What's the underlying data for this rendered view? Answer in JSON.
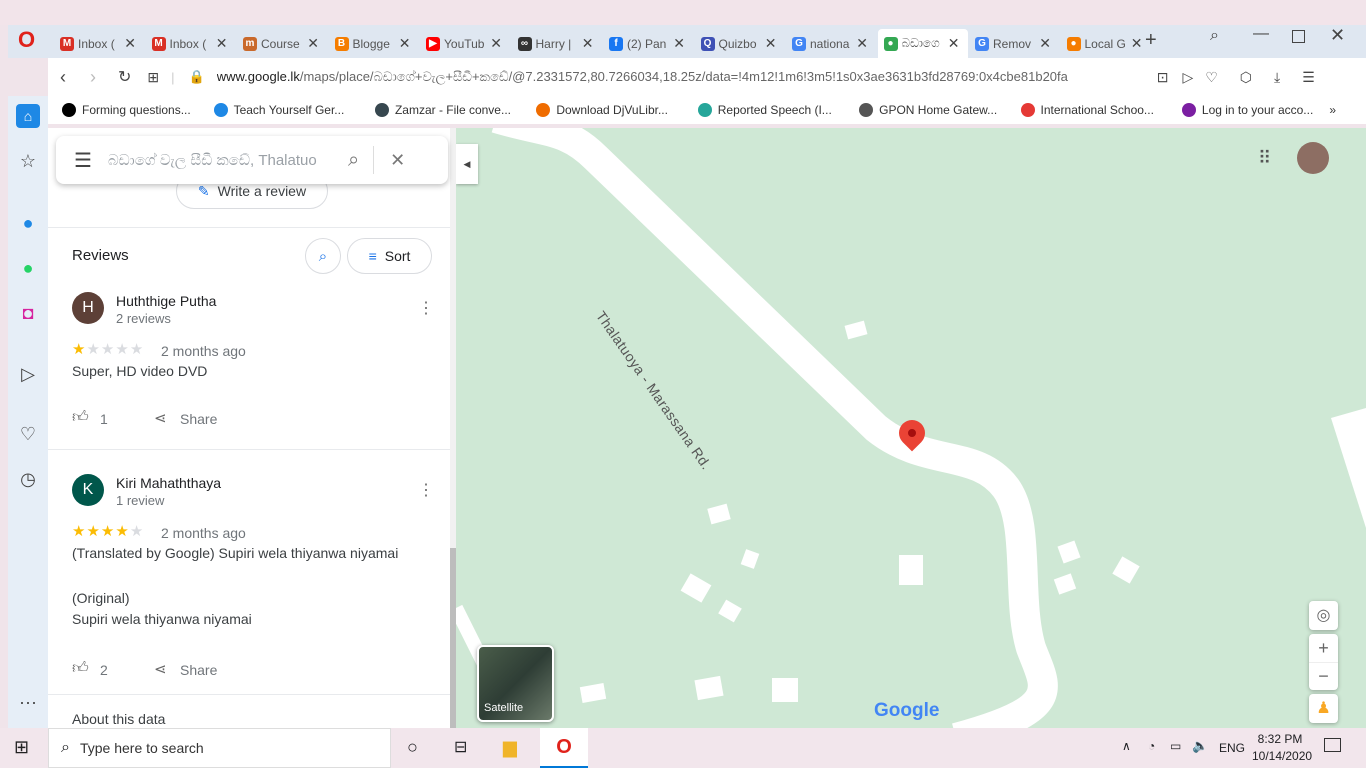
{
  "browser": {
    "tabs": [
      {
        "label": "Inbox (",
        "icon": "gmail-icon",
        "color": "#d93025",
        "glyph": "M"
      },
      {
        "label": "Inbox (",
        "icon": "gmail-icon",
        "color": "#d93025",
        "glyph": "M"
      },
      {
        "label": "Course",
        "icon": "coursera-icon",
        "color": "#c9692b",
        "glyph": "m"
      },
      {
        "label": "Blogge",
        "icon": "blogger-icon",
        "color": "#f57d00",
        "glyph": "B"
      },
      {
        "label": "YouTub",
        "icon": "youtube-icon",
        "color": "#ff0000",
        "glyph": "▶"
      },
      {
        "label": "Harry |",
        "icon": "goodreads-icon",
        "color": "#333333",
        "glyph": "∞"
      },
      {
        "label": "(2) Pan",
        "icon": "facebook-icon",
        "color": "#1877f2",
        "glyph": "f"
      },
      {
        "label": "Quizbo",
        "icon": "quizbox-icon",
        "color": "#3f51b5",
        "glyph": "Q"
      },
      {
        "label": "nationa",
        "icon": "google-icon",
        "color": "#4285f4",
        "glyph": "G"
      },
      {
        "label": "බඩාගෙ",
        "icon": "maps-pin-icon",
        "color": "#34a853",
        "glyph": "●",
        "active": true
      },
      {
        "label": "Remov",
        "icon": "google-icon",
        "color": "#4285f4",
        "glyph": "G"
      },
      {
        "label": "Local G",
        "icon": "location-icon",
        "color": "#f57c00",
        "glyph": "●"
      }
    ],
    "url_domain": "www.google.lk",
    "url_path": "/maps/place/බඩාගේ+වැල+සීඩී+කඩේ/@7.2331572,80.7266034,18.25z/data=!4m12!1m6!3m5!1s0x3ae3631b3fd28769:0x4cbe81b20fa",
    "bookmarks": [
      {
        "label": "Forming questions...",
        "color": "#000000"
      },
      {
        "label": "Teach Yourself Ger...",
        "color": "#1e88e5"
      },
      {
        "label": "Zamzar - File conve...",
        "color": "#37474f"
      },
      {
        "label": "Download DjVuLibr...",
        "color": "#ef6c00"
      },
      {
        "label": "Reported Speech (I...",
        "color": "#26a69a"
      },
      {
        "label": "GPON Home Gatew...",
        "color": "#555555"
      },
      {
        "label": "International Schoo...",
        "color": "#e53935"
      },
      {
        "label": "Log in to your acco...",
        "color": "#7b1fa2"
      }
    ],
    "more": "»"
  },
  "maps": {
    "search_value": "බඩාගේ වැල සීඩී කඩේ, Thalatuo",
    "write_review": "Write a review",
    "reviews_title": "Reviews",
    "sort_label": "Sort",
    "reviews": [
      {
        "initial": "H",
        "avatar_color": "#5d4037",
        "name": "Huththige Putha",
        "count": "2 reviews",
        "rating": 1,
        "time": "2 months ago",
        "text": "Super, HD video DVD",
        "likes": "1",
        "share": "Share"
      },
      {
        "initial": "K",
        "avatar_color": "#00574b",
        "name": "Kiri Mahaththaya",
        "count": "1 review",
        "rating": 4,
        "time": "2 months ago",
        "text": "(Translated by Google) Supiri wela thiyanwa niyamai",
        "original_label": "(Original)",
        "original": "Supiri wela thiyanwa niyamai",
        "likes": "2",
        "share": "Share"
      }
    ],
    "about": "About this data",
    "road_label": "Thalatuoya - Marassana Rd.",
    "satellite_label": "Satellite",
    "google_logo": "Google",
    "colors": {
      "map_bg": "#cfe8d5",
      "pin": "#ea4335",
      "star": "#fbbc04"
    }
  },
  "taskbar": {
    "search_placeholder": "Type here to search",
    "lang": "ENG",
    "time": "8:32 PM",
    "date": "10/14/2020"
  }
}
